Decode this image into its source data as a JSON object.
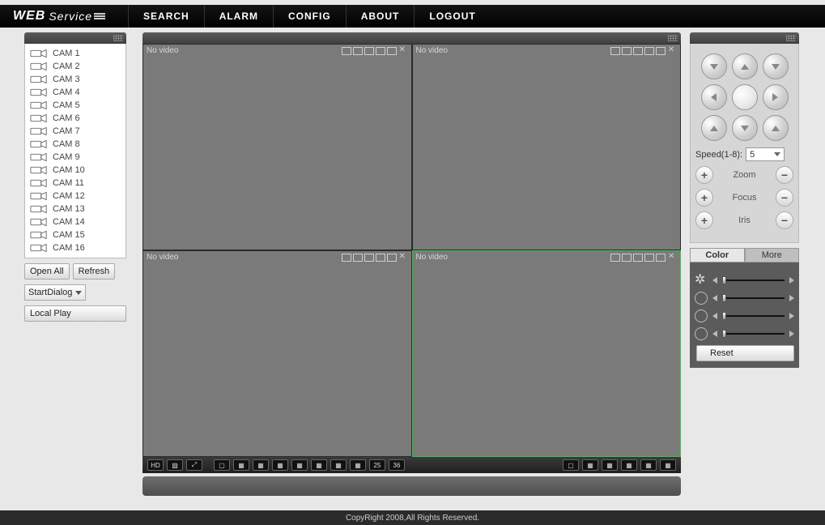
{
  "brand": {
    "web": "WEB",
    "service": "Service"
  },
  "nav": {
    "search": "SEARCH",
    "alarm": "ALARM",
    "config": "CONFIG",
    "about": "ABOUT",
    "logout": "LOGOUT"
  },
  "sidebar": {
    "cams": [
      "CAM 1",
      "CAM 2",
      "CAM 3",
      "CAM 4",
      "CAM 5",
      "CAM 6",
      "CAM 7",
      "CAM 8",
      "CAM 9",
      "CAM 10",
      "CAM 11",
      "CAM 12",
      "CAM 13",
      "CAM 14",
      "CAM 15",
      "CAM 16"
    ],
    "open_all": "Open All",
    "refresh": "Refresh",
    "start_dialog": "StartDialog",
    "local_play": "Local Play"
  },
  "tiles": {
    "no_video": "No video"
  },
  "toolbar": {
    "layout25": "25",
    "layout36": "36"
  },
  "ptz": {
    "speed_label": "Speed(1-8):",
    "speed_value": "5",
    "zoom": "Zoom",
    "focus": "Focus",
    "iris": "Iris"
  },
  "color": {
    "tab_color": "Color",
    "tab_more": "More",
    "reset": "Reset"
  },
  "footer": "CopyRight 2008,All Rights Reserved."
}
